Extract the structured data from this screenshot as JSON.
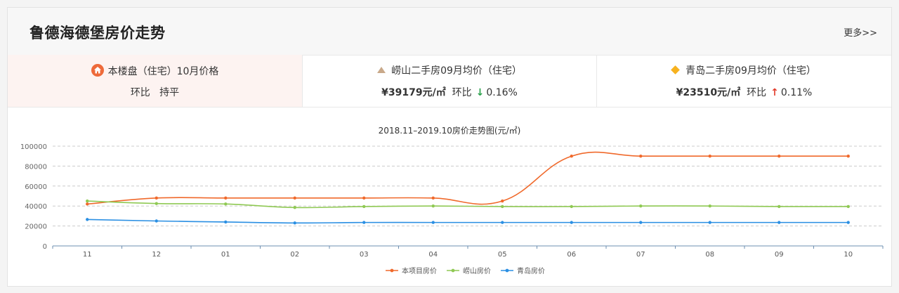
{
  "header": {
    "title": "鲁德海德堡房价走势",
    "more": "更多>>"
  },
  "stats": [
    {
      "label": "本楼盘（住宅）10月价格",
      "icon": "home-icon",
      "compare_text": "环比",
      "trend": "持平",
      "color": "#ee6a3a"
    },
    {
      "label": "崂山二手房09月均价（住宅）",
      "icon": "triangle-icon",
      "price": "¥39179元/㎡",
      "compare_text": "环比",
      "arrow": "↓",
      "change": "0.16%",
      "color": "#c9a98a"
    },
    {
      "label": "青岛二手房09月均价（住宅）",
      "icon": "diamond-icon",
      "price": "¥23510元/㎡",
      "compare_text": "环比",
      "arrow": "↑",
      "change": "0.11%",
      "color": "#f7b21f"
    }
  ],
  "chart_data": {
    "type": "line",
    "title": "2018.11–2019.10房价走势图(元/㎡)",
    "categories": [
      "11",
      "12",
      "01",
      "02",
      "03",
      "04",
      "05",
      "06",
      "07",
      "08",
      "09",
      "10"
    ],
    "ylim": [
      0,
      100000
    ],
    "yticks": [
      "0",
      "20000",
      "40000",
      "60000",
      "80000",
      "100000"
    ],
    "grid": true,
    "legend_position": "bottom",
    "series": [
      {
        "name": "本项目房价",
        "color": "#f0692b",
        "values": [
          42000,
          48000,
          48000,
          48000,
          48000,
          48000,
          45000,
          90000,
          90000,
          90000,
          90000,
          90000
        ]
      },
      {
        "name": "崂山房价",
        "color": "#8fc953",
        "values": [
          45000,
          42500,
          42000,
          38500,
          39500,
          40000,
          39500,
          39500,
          40000,
          40000,
          39500,
          39500
        ]
      },
      {
        "name": "青岛房价",
        "color": "#2a8fe3",
        "values": [
          26500,
          25000,
          24000,
          23000,
          23500,
          23500,
          23500,
          23500,
          23500,
          23500,
          23500,
          23500
        ]
      }
    ]
  }
}
